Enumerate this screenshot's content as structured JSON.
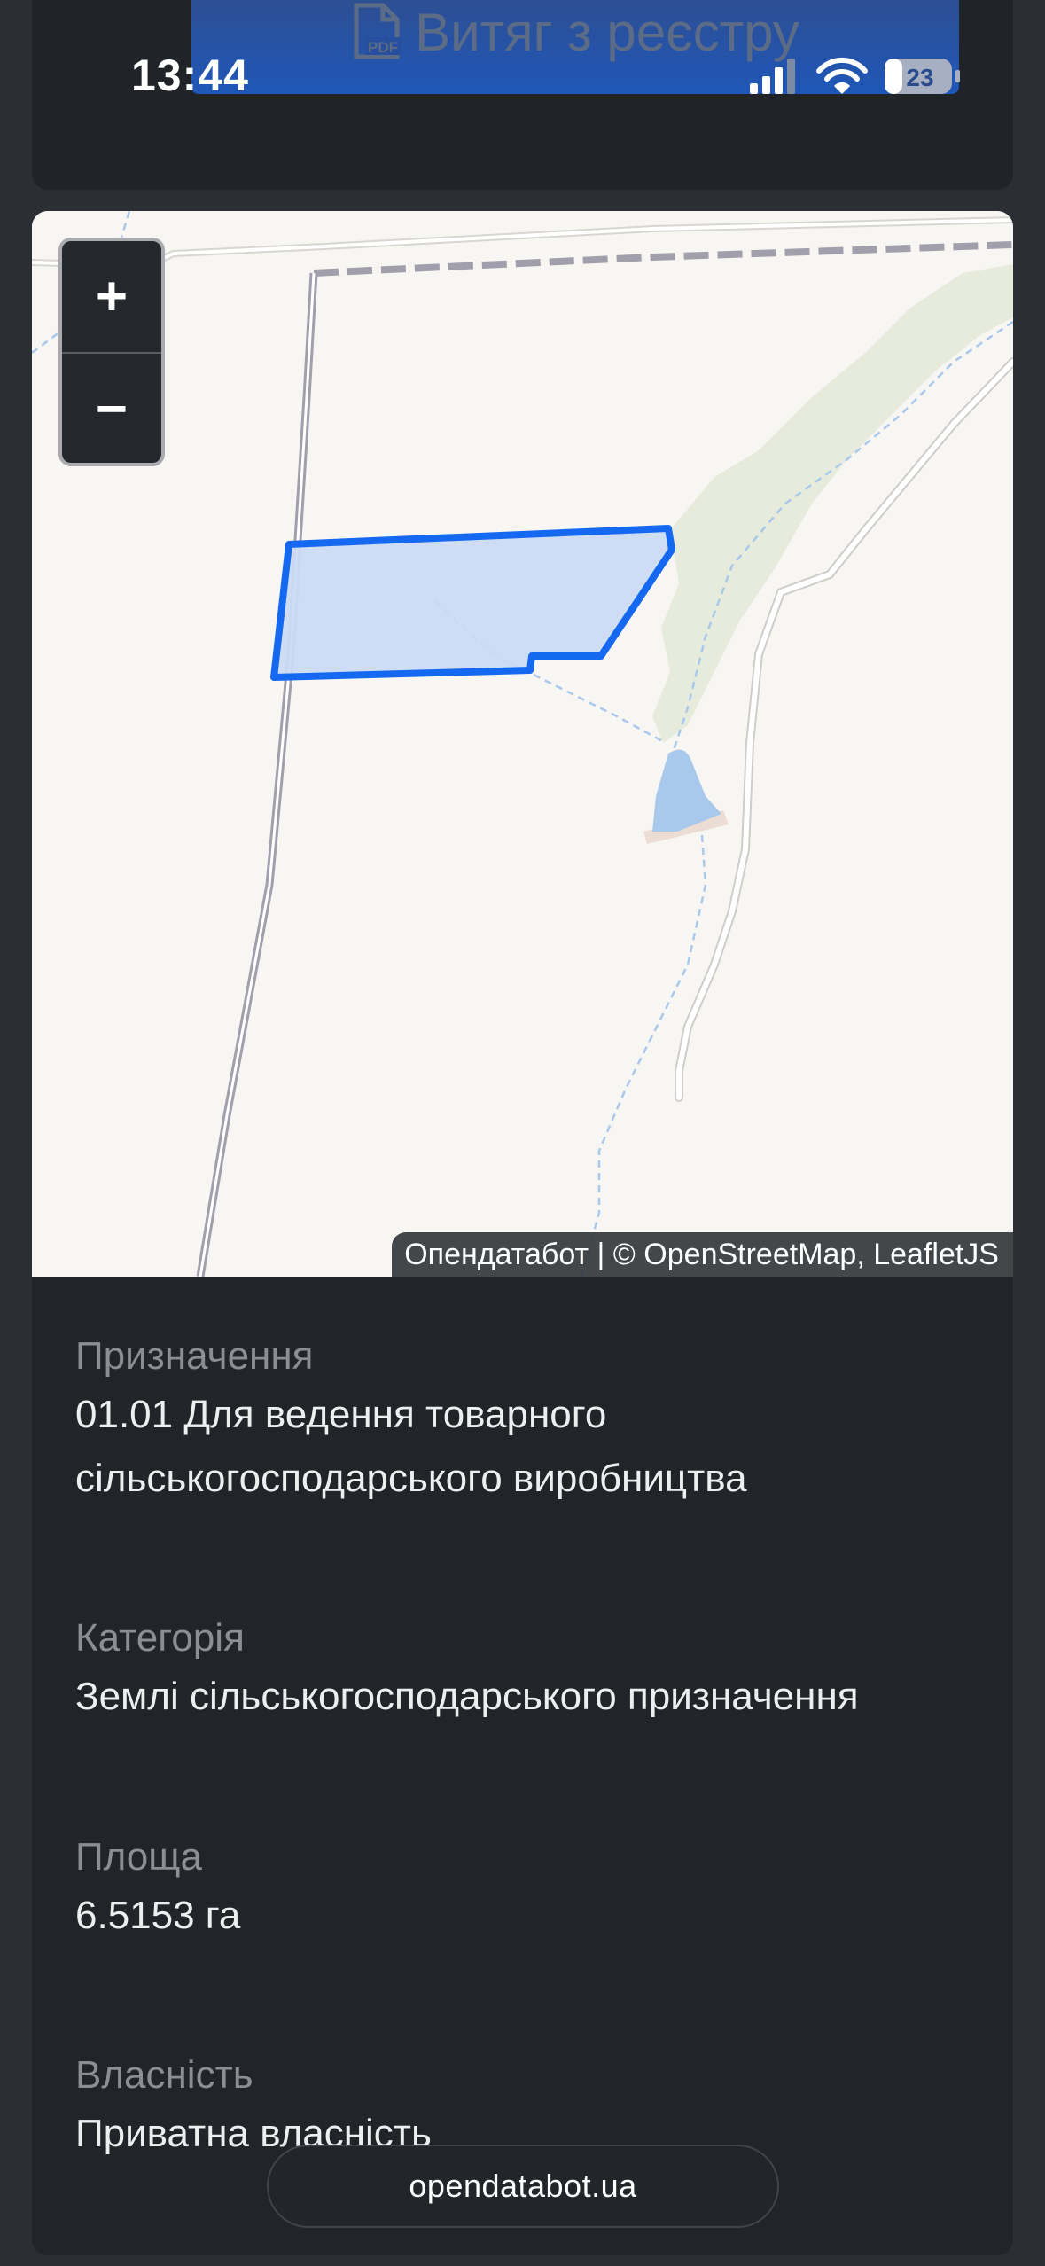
{
  "status_bar": {
    "time": "13:44",
    "battery": "23"
  },
  "header": {
    "pdf_button_label": "Витяг з реєстру",
    "pdf_icon_text": "PDF"
  },
  "map": {
    "zoom_in_label": "+",
    "zoom_out_label": "−",
    "attribution": "Опендатабот | © OpenStreetMap, LeafletJS",
    "colors": {
      "background": "#f8f6f2",
      "parcel_fill": "#cbdaf3",
      "parcel_stroke": "#1569f0",
      "road": "#a19fab",
      "forest": "#e6ebdc",
      "water": "#a8c8ec"
    }
  },
  "info": {
    "fields": [
      {
        "label": "Призначення",
        "value_lines": [
          "01.01 Для ведення товарного",
          "сільськогосподарського виробництва"
        ]
      },
      {
        "label": "Категорія",
        "value_lines": [
          "Землі сільськогосподарського призначення"
        ]
      },
      {
        "label": "Площа",
        "value_lines": [
          "6.5153 га"
        ]
      },
      {
        "label": "Власність",
        "value_lines": [
          "Приватна власність"
        ]
      }
    ]
  },
  "footer": {
    "url": "opendatabot.ua"
  }
}
